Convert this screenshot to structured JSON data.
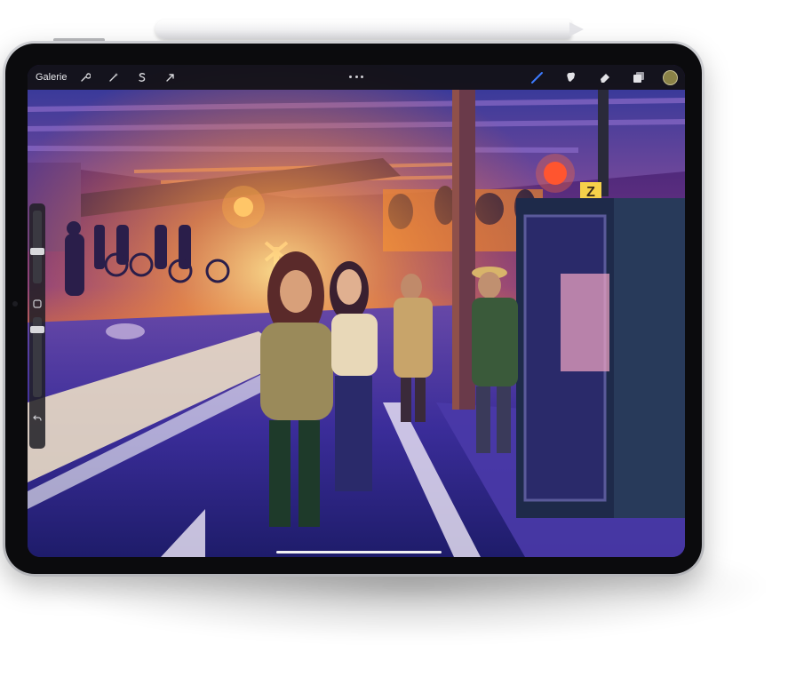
{
  "topbar": {
    "gallery_label": "Galerie",
    "left_tools": [
      "wrench-icon",
      "magic-wand-icon",
      "selection-icon",
      "transform-arrow-icon"
    ],
    "more_icon": "ellipsis-icon",
    "right_tools": [
      "brush-icon",
      "smudge-icon",
      "eraser-icon",
      "layers-icon"
    ],
    "brush_active_color": "#3d7bff",
    "color_swatch": "#8a8247"
  },
  "sidebar": {
    "icons": [
      "modify-square-icon",
      "undo-icon"
    ]
  },
  "artwork": {
    "scene": "painting",
    "sign_letter": "Z"
  },
  "colors": {
    "screen_bg": "#1a1030",
    "toolbar_bg": "#121216",
    "warm_light": "#ffb347",
    "cool_shadow": "#3a2a8c"
  }
}
